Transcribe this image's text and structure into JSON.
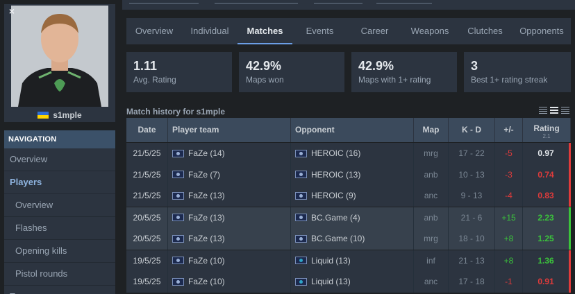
{
  "player": {
    "name": "s1mple",
    "close_label": "×",
    "country_icon": "ukraine-flag-icon"
  },
  "navigation": {
    "header": "NAVIGATION",
    "items": [
      {
        "label": "Overview"
      },
      {
        "label": "Players"
      },
      {
        "label": "Overview"
      },
      {
        "label": "Flashes"
      },
      {
        "label": "Opening kills"
      },
      {
        "label": "Pistol rounds"
      },
      {
        "label": "Teams"
      }
    ]
  },
  "tabs": [
    "Overview",
    "Individual",
    "Matches",
    "Events",
    "Career",
    "Weapons",
    "Clutches",
    "Opponents"
  ],
  "active_tab": "Matches",
  "stats": [
    {
      "value": "1.11",
      "label": "Avg. Rating"
    },
    {
      "value": "42.9%",
      "label": "Maps won"
    },
    {
      "value": "42.9%",
      "label": "Maps with 1+ rating"
    },
    {
      "value": "3",
      "label": "Best 1+ rating streak"
    }
  ],
  "match_history": {
    "title": "Match history for s1mple",
    "columns": {
      "date": "Date",
      "team": "Player team",
      "opponent": "Opponent",
      "map": "Map",
      "kd": "K - D",
      "diff": "+/-",
      "rating": "Rating",
      "rating_version": "2.1"
    },
    "rows": [
      {
        "date": "21/5/25",
        "team": "FaZe (14)",
        "opponent": "HEROIC (16)",
        "map": "mrg",
        "kd": "17 - 22",
        "diff": "-5",
        "rating": "0.97"
      },
      {
        "date": "21/5/25",
        "team": "FaZe (7)",
        "opponent": "HEROIC (13)",
        "map": "anb",
        "kd": "10 - 13",
        "diff": "-3",
        "rating": "0.74"
      },
      {
        "date": "21/5/25",
        "team": "FaZe (13)",
        "opponent": "HEROIC (9)",
        "map": "anc",
        "kd": "9 - 13",
        "diff": "-4",
        "rating": "0.83"
      },
      {
        "date": "20/5/25",
        "team": "FaZe (13)",
        "opponent": "BC.Game (4)",
        "map": "anb",
        "kd": "21 - 6",
        "diff": "+15",
        "rating": "2.23"
      },
      {
        "date": "20/5/25",
        "team": "FaZe (13)",
        "opponent": "BC.Game (10)",
        "map": "mrg",
        "kd": "18 - 10",
        "diff": "+8",
        "rating": "1.25"
      },
      {
        "date": "19/5/25",
        "team": "FaZe (10)",
        "opponent": "Liquid (13)",
        "map": "inf",
        "kd": "21 - 13",
        "diff": "+8",
        "rating": "1.36"
      },
      {
        "date": "19/5/25",
        "team": "FaZe (10)",
        "opponent": "Liquid (13)",
        "map": "anc",
        "kd": "17 - 18",
        "diff": "-1",
        "rating": "0.91"
      }
    ]
  },
  "colors": {
    "negative": "#e03b3b",
    "positive": "#3bc43b",
    "accent": "#6b9ee5"
  }
}
